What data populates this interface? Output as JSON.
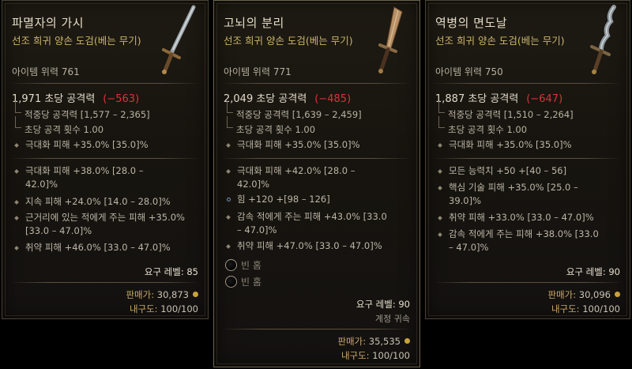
{
  "tooltips": [
    {
      "name": "파멸자의 가시",
      "type": "선조 희귀 양손 도검(베는 무기)",
      "item_power": "아이템 위력 761",
      "dps": "1,971 초당 공격력",
      "dps_delta": "−563",
      "damage_per_hit": "적중당 공격력 [1,577 – 2,365]",
      "attacks_per_second": "초당 공격 횟수 1.00",
      "implicit": "극대화 피해 +35.0% [35.0]%",
      "affixes": [
        "극대화 피해 +38.0% [28.0 – 42.0]%",
        "지속 피해 +24.0% [14.0 – 28.0]%",
        "근거리에 있는 적에게 주는 피해 +35.0% [33.0 – 47.0]%",
        "취약 피해 +46.0% [33.0 – 47.0]%"
      ],
      "required_level": "요구 레벨: 85",
      "sell_label": "판매가:",
      "sell_value": "30,873",
      "durability_label": "내구도:",
      "durability_value": "100/100"
    },
    {
      "name": "고뇌의 분리",
      "type": "선조 희귀 양손 도검(베는 무기)",
      "item_power": "아이템 위력 771",
      "dps": "2,049 초당 공격력",
      "dps_delta": "−485",
      "damage_per_hit": "적중당 공격력 [1,639 – 2,459]",
      "attacks_per_second": "초당 공격 횟수 1.00",
      "implicit": "극대화 피해 +35.0% [35.0]%",
      "affixes": [
        "극대화 피해 +42.0% [28.0 – 42.0]%",
        "힘 +120 +[98 – 126]",
        "감속 적에게 주는 피해 +43.0% [33.0 – 47.0]%",
        "취약 피해 +47.0% [33.0 – 47.0]%"
      ],
      "sockets": [
        "빈 홈",
        "빈 홈"
      ],
      "required_level": "요구 레벨: 90",
      "account_bound": "계정 귀속",
      "sell_label": "판매가:",
      "sell_value": "35,535",
      "durability_label": "내구도:",
      "durability_value": "100/100"
    },
    {
      "name": "역병의 면도날",
      "type": "선조 희귀 양손 도검(베는 무기)",
      "item_power": "아이템 위력 750",
      "dps": "1,887 초당 공격력",
      "dps_delta": "−647",
      "damage_per_hit": "적중당 공격력 [1,510 – 2,264]",
      "attacks_per_second": "초당 공격 횟수 1.00",
      "implicit": "극대화 피해 +35.0% [35.0]%",
      "affixes": [
        "모든 능력치 +50 +[40 – 56]",
        "핵심 기술 피해 +35.0% [25.0 – 39.0]%",
        "취약 피해 +33.0% [33.0 – 47.0]%",
        "감속 적에게 주는 피해 +38.0% [33.0 – 47.0]%"
      ],
      "required_level": "요구 레벨: 90",
      "sell_label": "판매가:",
      "sell_value": "30,096",
      "durability_label": "내구도:",
      "durability_value": "100/100"
    }
  ],
  "colors": {
    "item_name": "#e4dcc6",
    "item_type": "#c9b56a",
    "dps_delta": "#d9333a",
    "label_gold": "#c9a86a"
  }
}
